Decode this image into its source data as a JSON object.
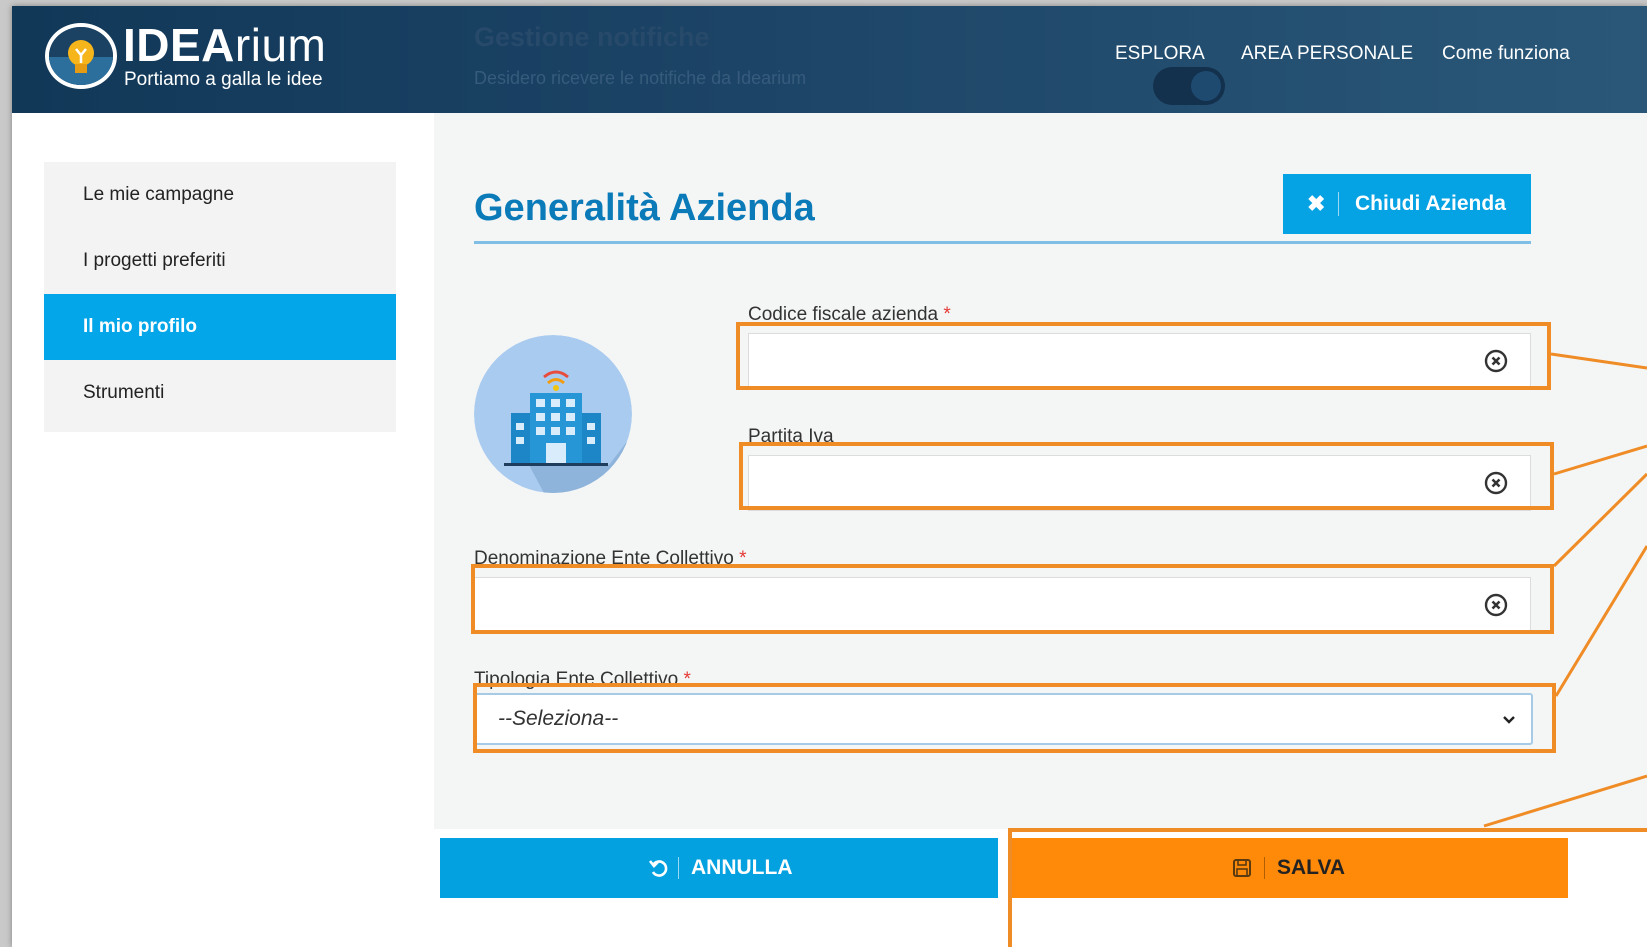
{
  "header": {
    "logo_bold": "IDEA",
    "logo_light": "rium",
    "tagline": "Portiamo a galla le idee",
    "nav": [
      "ESPLORA",
      "AREA PERSONALE",
      "Come funziona"
    ],
    "background_title": "Gestione notifiche",
    "background_subtitle": "Desidero ricevere le notifiche da Idearium",
    "background_toggle_on": true
  },
  "sidebar": {
    "items": [
      {
        "label": "Le mie campagne",
        "active": false
      },
      {
        "label": "I progetti preferiti",
        "active": false
      },
      {
        "label": "Il mio profilo",
        "active": true
      },
      {
        "label": "Strumenti",
        "active": false
      }
    ]
  },
  "main": {
    "title": "Generalità Azienda",
    "close_button": "Chiudi Azienda",
    "avatar_icon": "building-icon",
    "fields": {
      "codice_fiscale": {
        "label": "Codice fiscale azienda",
        "required_mark": "*",
        "value": ""
      },
      "partita_iva": {
        "label": "Partita Iva",
        "value": ""
      },
      "denominazione": {
        "label": "Denominazione Ente Collettivo",
        "required_mark": "*",
        "value": ""
      },
      "tipologia": {
        "label": "Tipologia Ente Collettivo",
        "required_mark": "*",
        "selected": "--Seleziona--"
      }
    }
  },
  "buttons": {
    "annulla": "ANNULLA",
    "salva": "SALVA"
  },
  "colors": {
    "header_bg": "#16395a",
    "accent_blue": "#05a2e4",
    "title_blue": "#0a7ab8",
    "highlight_orange": "#ef8c26",
    "save_orange": "#ff8a0a"
  }
}
